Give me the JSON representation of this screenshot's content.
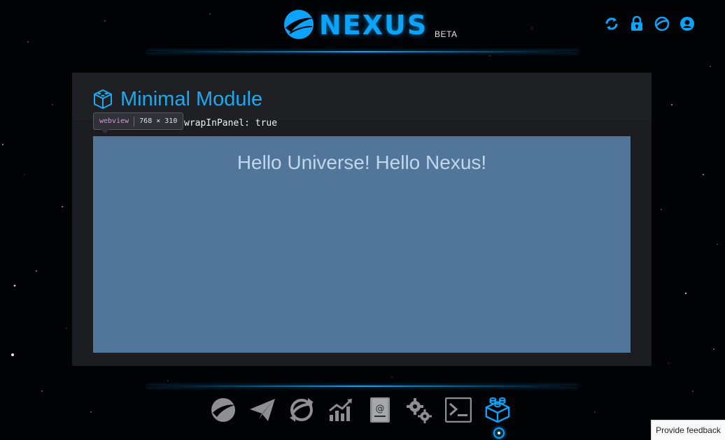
{
  "header": {
    "brand": "NEXUS",
    "badge": "BETA",
    "icons": [
      "sync-icon",
      "lock-icon",
      "network-icon",
      "user-icon"
    ]
  },
  "module": {
    "title": "Minimal Module",
    "title_icon": "module-cube-icon",
    "wrap_label": "wrapInPanel: true",
    "content": "Hello Universe! Hello Nexus!"
  },
  "inspector": {
    "tag": "webview",
    "dims": "768 × 310"
  },
  "nav": {
    "items": [
      {
        "name": "overview",
        "icon": "nexus-logo-icon"
      },
      {
        "name": "send",
        "icon": "paper-plane-icon"
      },
      {
        "name": "transactions",
        "icon": "transactions-icon"
      },
      {
        "name": "market",
        "icon": "chart-icon"
      },
      {
        "name": "address-book",
        "icon": "address-book-icon"
      },
      {
        "name": "settings",
        "icon": "gears-icon"
      },
      {
        "name": "console",
        "icon": "terminal-icon"
      },
      {
        "name": "modules",
        "icon": "modules-icon",
        "active": true
      }
    ]
  },
  "feedback_label": "Provide feedback",
  "colors": {
    "accent": "#0ca4fb",
    "panel": "#1c1d20",
    "webview_bg": "#52759a",
    "nav_icon": "#8e8f91"
  }
}
